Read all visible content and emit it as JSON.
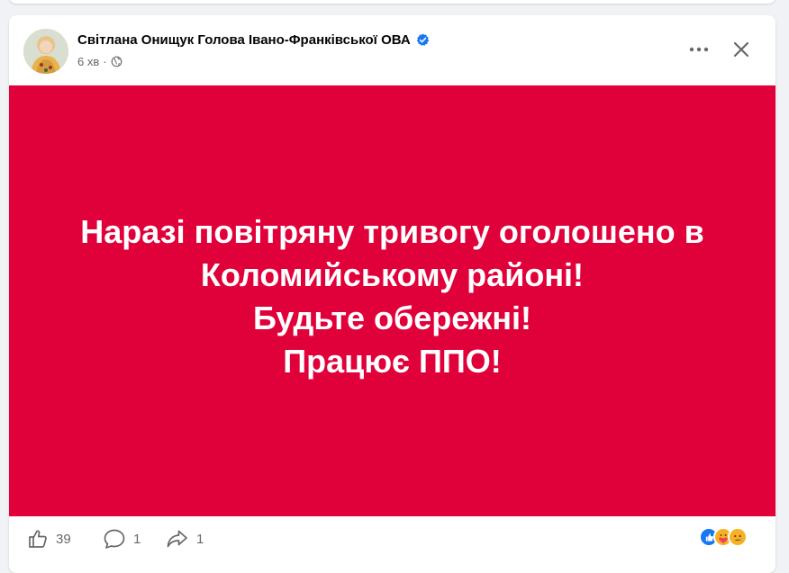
{
  "post": {
    "author": "Світлана Онищук Голова Івано-Франківської ОВА",
    "verified_icon": "verified-badge-icon",
    "time": "6 хв",
    "separator": "·",
    "audience_icon": "globe-icon"
  },
  "banner": {
    "background": "#e0003a",
    "lines": [
      "Наразі повітряну тривогу оголошено в",
      "Коломийському районі!",
      "Будьте обережні!",
      "Працює ППО!"
    ]
  },
  "footer": {
    "likes_count": "39",
    "comments_count": "1",
    "shares_count": "1",
    "reactions": [
      "like-icon",
      "care-icon",
      "sad-icon"
    ]
  },
  "colors": {
    "accent": "#1877f2",
    "secondary_text": "#65676b"
  }
}
